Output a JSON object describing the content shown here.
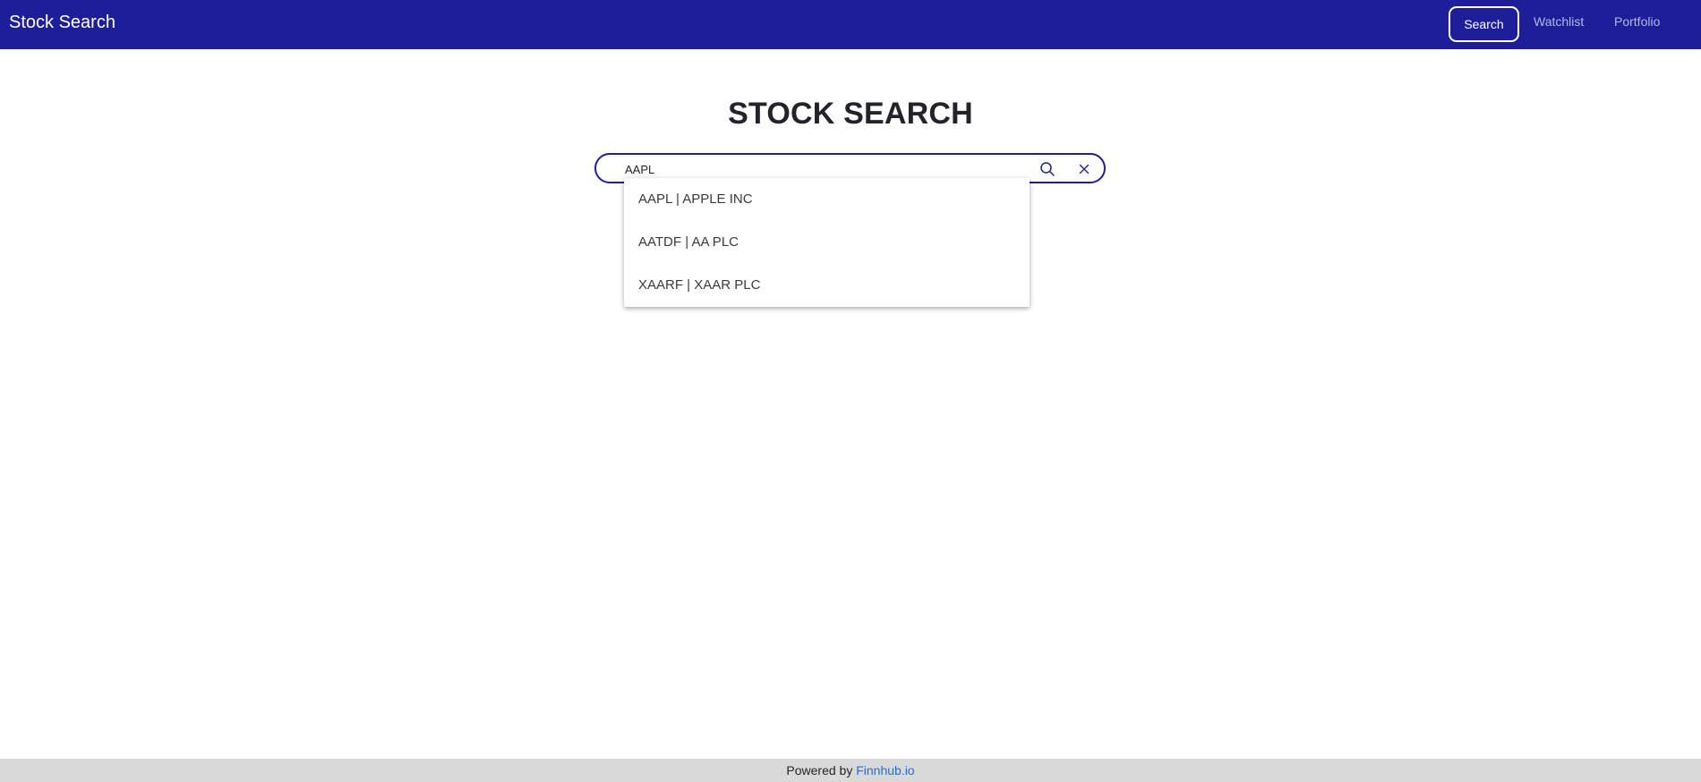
{
  "navbar": {
    "brand": "Stock Search",
    "links": [
      {
        "label": "Search",
        "active": true
      },
      {
        "label": "Watchlist",
        "active": false
      },
      {
        "label": "Portfolio",
        "active": false
      }
    ],
    "colors": {
      "background": "#1e1e9b",
      "active_text": "#ffffff",
      "inactive_text": "#b4b7e6"
    }
  },
  "main": {
    "title": "STOCK SEARCH",
    "search": {
      "value": "AAPL",
      "placeholder": "",
      "icons": [
        "search-icon",
        "close-icon"
      ],
      "border_color": "#1e1e9b"
    },
    "suggestions": [
      {
        "label": "AAPL | APPLE INC"
      },
      {
        "label": "AATDF | AA PLC"
      },
      {
        "label": "XAARF | XAAR PLC"
      }
    ]
  },
  "footer": {
    "prefix": "Powered by ",
    "link_label": "Finnhub.io",
    "link_color": "#1a6ef0"
  }
}
